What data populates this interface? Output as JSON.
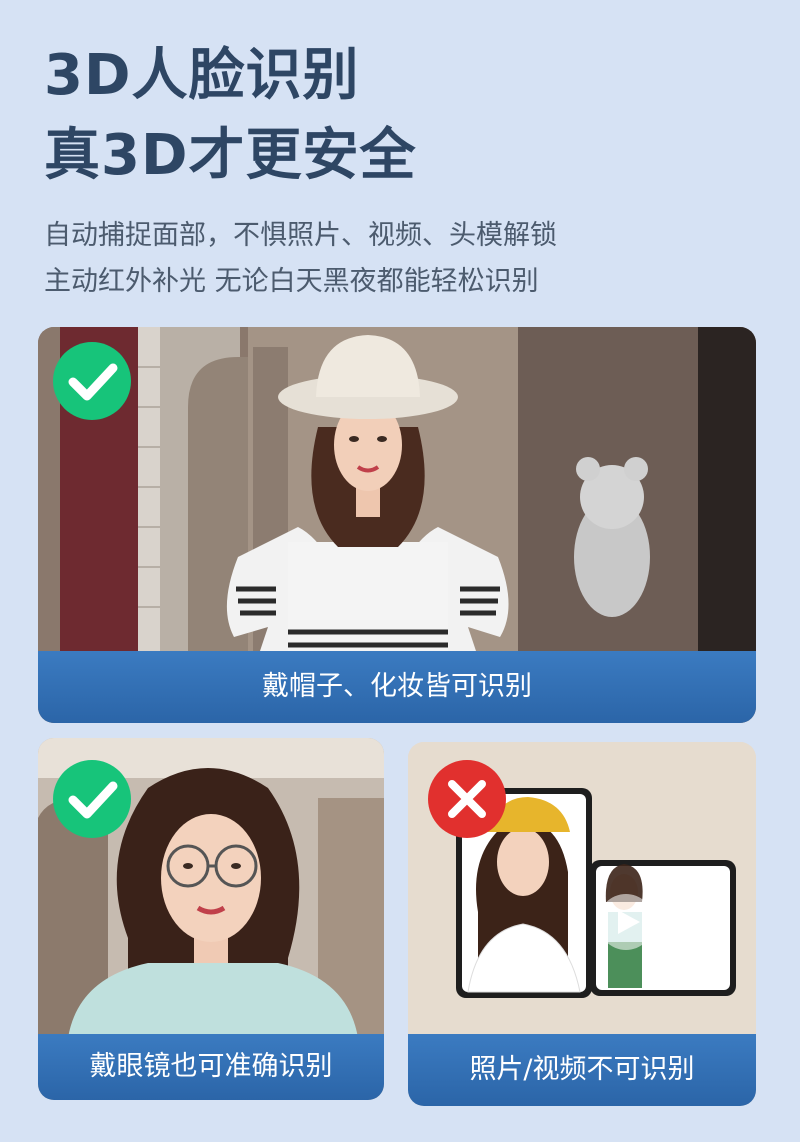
{
  "header": {
    "title_line1": "3D人脸识别",
    "title_line2": "真3D才更安全",
    "subtitle_line1": "自动捕捉面部，不惧照片、视频、头模解锁",
    "subtitle_line2": "主动红外补光 无论白天黑夜都能轻松识别"
  },
  "cards": {
    "hat_makeup": {
      "caption": "戴帽子、化妆皆可识别",
      "status_icon": "check-icon"
    },
    "glasses": {
      "caption": "戴眼镜也可准确识别",
      "status_icon": "check-icon"
    },
    "photo_video": {
      "caption": "照片/视频不可识别",
      "status_icon": "cross-icon"
    }
  },
  "colors": {
    "page_background": "#d6e2f4",
    "title_text": "#2e4664",
    "caption_bar": "#3b7bc1",
    "success_badge": "#17c47a",
    "reject_badge": "#e1302e"
  }
}
